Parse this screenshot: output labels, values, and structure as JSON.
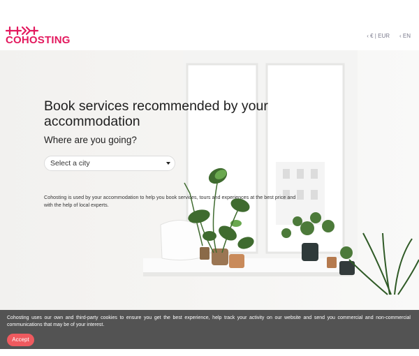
{
  "brand": {
    "name": "COHOSTING",
    "color": "#e3195e"
  },
  "header": {
    "currency_label": "‹ € | EUR",
    "language_label": "‹ EN"
  },
  "hero": {
    "title": "Book services recommended by your accommodation",
    "subtitle": "Where are you going?",
    "city_select": {
      "selected": "Select a city"
    },
    "description": "Cohosting is used by your accommodation to help you book services, tours and experiences at the best price and with the help of local experts."
  },
  "cookie_banner": {
    "text": "Cohosting uses our own and third-party cookies to ensure you get the best experience, help track your activity on our website and send you commercial and non-commercial communications that may be of your interest.",
    "accept_label": "Accept",
    "accept_color": "#ef5a5f"
  }
}
